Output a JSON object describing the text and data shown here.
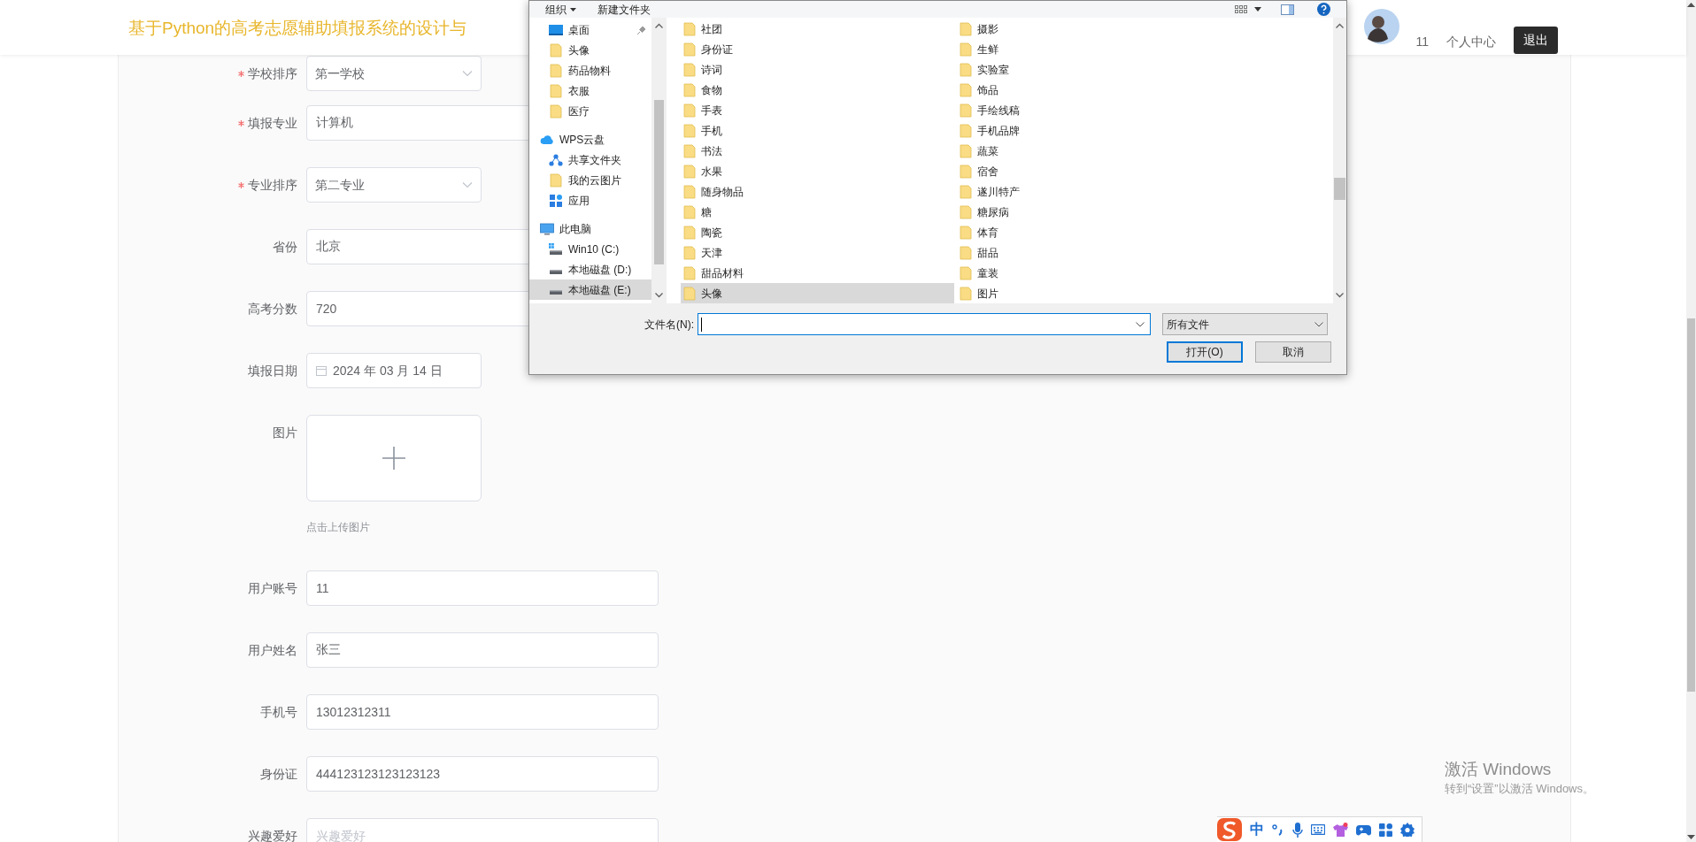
{
  "header": {
    "title": "基于Python的高考志愿辅助填报系统的设计与",
    "username": "11",
    "profile_link": "个人中心",
    "logout": "退出"
  },
  "form": {
    "fields": [
      {
        "label": "学校排序",
        "required": true,
        "kind": "select",
        "value": "第一学校"
      },
      {
        "label": "填报专业",
        "required": true,
        "kind": "text",
        "value": "计算机"
      },
      {
        "label": "专业排序",
        "required": true,
        "kind": "select",
        "value": "第二专业"
      },
      {
        "label": "省份",
        "required": false,
        "kind": "text",
        "value": "北京"
      },
      {
        "label": "高考分数",
        "required": false,
        "kind": "text",
        "value": "720"
      },
      {
        "label": "填报日期",
        "required": false,
        "kind": "date",
        "value": "2024 年 03 月 14 日"
      },
      {
        "label": "图片",
        "required": false,
        "kind": "upload",
        "hint": "点击上传图片"
      },
      {
        "label": "用户账号",
        "required": false,
        "kind": "text",
        "value": "11"
      },
      {
        "label": "用户姓名",
        "required": false,
        "kind": "text",
        "value": "张三"
      },
      {
        "label": "手机号",
        "required": false,
        "kind": "text",
        "value": "13012312311"
      },
      {
        "label": "身份证",
        "required": false,
        "kind": "text",
        "value": "444123123123123123"
      },
      {
        "label": "兴趣爱好",
        "required": false,
        "kind": "text",
        "placeholder": "兴趣爱好"
      }
    ]
  },
  "file_dialog": {
    "toolbar": [
      "组织",
      "新建文件夹"
    ],
    "nav": [
      {
        "label": "桌面",
        "kind": "desktop",
        "pinned": true,
        "selected": false
      },
      {
        "label": "头像",
        "kind": "folder",
        "pinned": false,
        "selected": false
      },
      {
        "label": "药品物料",
        "kind": "folder",
        "pinned": false,
        "selected": false
      },
      {
        "label": "衣服",
        "kind": "folder",
        "pinned": false,
        "selected": false
      },
      {
        "label": "医疗",
        "kind": "folder",
        "pinned": false,
        "selected": false
      },
      {
        "label": "WPS云盘",
        "kind": "cloud",
        "pinned": false,
        "selected": false,
        "children": [
          {
            "label": "共享文件夹",
            "kind": "share",
            "pinned": false,
            "selected": false
          },
          {
            "label": "我的云图片",
            "kind": "folder",
            "pinned": false,
            "selected": false
          },
          {
            "label": "应用",
            "kind": "apps",
            "pinned": false,
            "selected": false
          }
        ]
      },
      {
        "label": "此电脑",
        "kind": "pc",
        "pinned": false,
        "selected": false,
        "children": [
          {
            "label": "Win10 (C:)",
            "kind": "system_drive",
            "pinned": false,
            "selected": false
          },
          {
            "label": "本地磁盘 (D:)",
            "kind": "drive",
            "pinned": false,
            "selected": false
          },
          {
            "label": "本地磁盘 (E:)",
            "kind": "drive",
            "pinned": false,
            "selected": true
          }
        ]
      }
    ],
    "files": [
      {
        "name": "社团",
        "selected": false
      },
      {
        "name": "身份证",
        "selected": false
      },
      {
        "name": "诗词",
        "selected": false
      },
      {
        "name": "食物",
        "selected": false
      },
      {
        "name": "手表",
        "selected": false
      },
      {
        "name": "手机",
        "selected": false
      },
      {
        "name": "书法",
        "selected": false
      },
      {
        "name": "水果",
        "selected": false
      },
      {
        "name": "随身物品",
        "selected": false
      },
      {
        "name": "糖",
        "selected": false
      },
      {
        "name": "陶瓷",
        "selected": false
      },
      {
        "name": "天津",
        "selected": false
      },
      {
        "name": "甜品材料",
        "selected": false
      },
      {
        "name": "头像",
        "selected": true
      },
      {
        "name": "摄影",
        "selected": false
      },
      {
        "name": "生鲜",
        "selected": false
      },
      {
        "name": "实验室",
        "selected": false
      },
      {
        "name": "饰品",
        "selected": false
      },
      {
        "name": "手绘线稿",
        "selected": false
      },
      {
        "name": "手机品牌",
        "selected": false
      },
      {
        "name": "蔬菜",
        "selected": false
      },
      {
        "name": "宿舍",
        "selected": false
      },
      {
        "name": "遂川特产",
        "selected": false
      },
      {
        "name": "糖尿病",
        "selected": false
      },
      {
        "name": "体育",
        "selected": false
      },
      {
        "name": "甜品",
        "selected": false
      },
      {
        "name": "童装",
        "selected": false
      },
      {
        "name": "图片",
        "selected": false
      }
    ],
    "filename_label": "文件名(N):",
    "file_type": "所有文件",
    "buttons": [
      {
        "label": "打开(O)",
        "default": true
      },
      {
        "label": "取消",
        "default": false
      }
    ]
  },
  "os_notice": {
    "title": "激活 Windows",
    "hint": "转到“设置”以激活 Windows。"
  },
  "ime_toolbar": {
    "mode": "中"
  }
}
